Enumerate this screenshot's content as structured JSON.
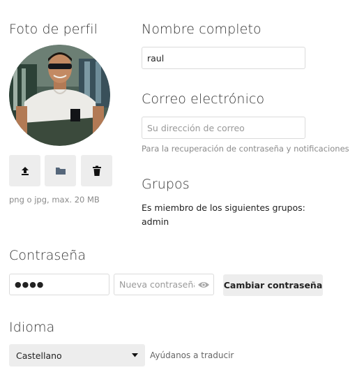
{
  "profile_picture": {
    "title": "Foto de perfil",
    "hint": "png o jpg, max. 20 MB",
    "buttons": [
      "upload-icon",
      "folder-icon",
      "trash-icon"
    ]
  },
  "full_name": {
    "title": "Nombre completo",
    "value": "raul"
  },
  "email": {
    "title": "Correo electrónico",
    "placeholder": "Su dirección de correo",
    "hint": "Para la recuperación de contraseña y notificaciones"
  },
  "groups": {
    "title": "Grupos",
    "member_label": "Es miembro de los siguientes grupos:",
    "list": "admin"
  },
  "password": {
    "title": "Contraseña",
    "current_value": "●●●●",
    "new_placeholder": "Nueva contraseña",
    "change_button": "Cambiar contraseña"
  },
  "language": {
    "title": "Idioma",
    "selected": "Castellano",
    "help_link": "Ayúdanos a traducir"
  },
  "colors": {
    "button_bg": "#ededed",
    "border": "#dbdbdb",
    "hint_text": "#8a8a8a",
    "folder_icon": "#55667a"
  }
}
